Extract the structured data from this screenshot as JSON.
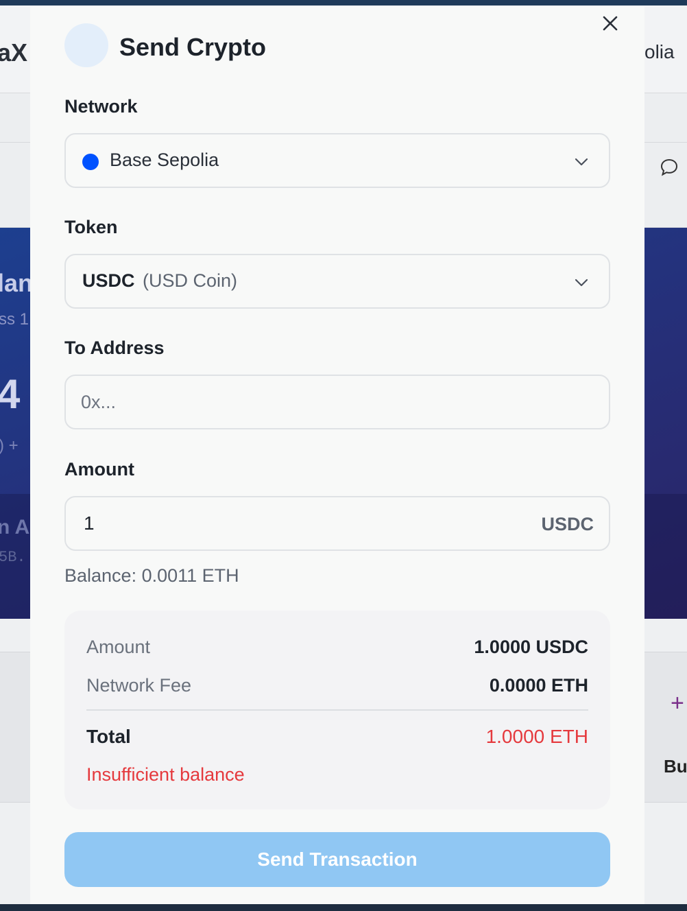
{
  "background": {
    "app_title_fragment": "aX",
    "network_fragment": "olia",
    "hero_fragments": [
      "lan",
      "ss 1",
      "4",
      ") +",
      "n Ac",
      "5B."
    ],
    "action_fragment": "Bu"
  },
  "modal": {
    "title": "Send Crypto",
    "icons": {
      "close": "close-icon",
      "avatar": "token-avatar"
    },
    "network": {
      "label": "Network",
      "selected": "Base Sepolia",
      "dot_color": "#0052ff"
    },
    "token": {
      "label": "Token",
      "symbol": "USDC",
      "name": "(USD Coin)"
    },
    "to_address": {
      "label": "To Address",
      "value": "",
      "placeholder": "0x..."
    },
    "amount": {
      "label": "Amount",
      "value": "1",
      "unit": "USDC"
    },
    "balance_text": "Balance: 0.0011 ETH",
    "summary": {
      "amount_label": "Amount",
      "amount_value": "1.0000 USDC",
      "fee_label": "Network Fee",
      "fee_value": "0.0000 ETH",
      "total_label": "Total",
      "total_value": "1.0000 ETH",
      "error": "Insufficient balance"
    },
    "submit_label": "Send Transaction"
  },
  "colors": {
    "accent_disabled": "#90c7f3",
    "error": "#e5393d",
    "network_dot": "#0052ff"
  }
}
